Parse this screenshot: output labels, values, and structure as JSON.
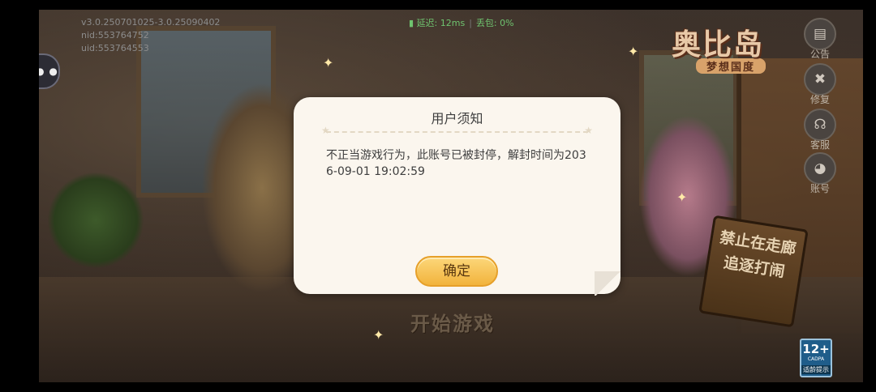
{
  "hud": {
    "version": "v3.0.250701025-3.0.25090402",
    "nid": "nid:553764752",
    "uid": "uid:553764553",
    "latency": "延迟: 12ms",
    "packet_loss": "丢包: 0%"
  },
  "sidebar": {
    "items": [
      {
        "label": "公告",
        "icon": "notice-icon"
      },
      {
        "label": "修复",
        "icon": "repair-icon"
      },
      {
        "label": "客服",
        "icon": "customer-service-icon"
      },
      {
        "label": "账号",
        "icon": "account-icon"
      }
    ]
  },
  "logo": {
    "title": "奥比岛",
    "subtitle": "梦想国度"
  },
  "scene": {
    "sign_line1": "禁止在走廊",
    "sign_line2": "追逐打闹"
  },
  "start_label": "开始游戏",
  "dialog": {
    "title": "用户须知",
    "message": "不正当游戏行为，此账号已被封停，解封时间为2036-09-01 19:02:59",
    "ok_label": "确定"
  },
  "age_rating": {
    "rating": "12+",
    "org": "CADPA",
    "caption": "适龄提示"
  },
  "colors": {
    "latency_green": "#6fc46f",
    "button_gold": "#f2b33c",
    "dialog_bg": "#fbf6ee"
  }
}
